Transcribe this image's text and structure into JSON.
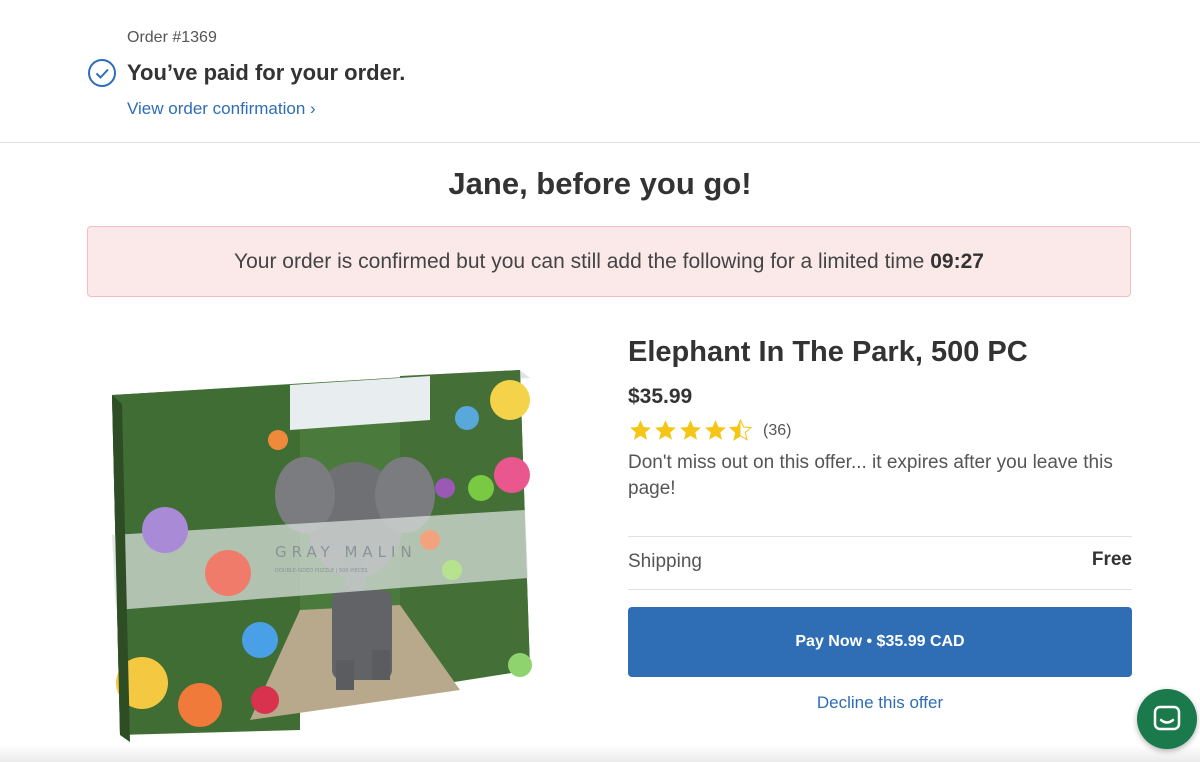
{
  "header": {
    "order_number": "Order #1369",
    "paid_title": "You’ve paid for your order.",
    "view_confirmation": "View order confirmation ›"
  },
  "greeting": "Jane, before you go!",
  "banner": {
    "message": "Your order is confirmed but you can still add the following for a limited time",
    "timer": "09:27"
  },
  "product": {
    "title": "Elephant In The Park, 500 PC",
    "price": "$35.99",
    "rating": 4.5,
    "rating_max": 5,
    "review_count": "(36)",
    "offer_text": "Don't miss out on this offer... it expires after you leave this page!",
    "image_brand": "GRAY MALIN",
    "image_caption": "DOUBLE-SIDED PUZZLE | 500 PIECES"
  },
  "shipping": {
    "label": "Shipping",
    "value": "Free"
  },
  "actions": {
    "pay_now": "Pay Now • $35.99 CAD",
    "decline": "Decline this offer"
  },
  "icons": {
    "check": "check-circle-icon",
    "star": "star-icon",
    "chat": "chat-icon"
  },
  "colors": {
    "accent": "#2f6eb5",
    "star": "#f5c518",
    "banner_bg": "#fbe9e9",
    "chat_bg": "#1b7a4b"
  }
}
